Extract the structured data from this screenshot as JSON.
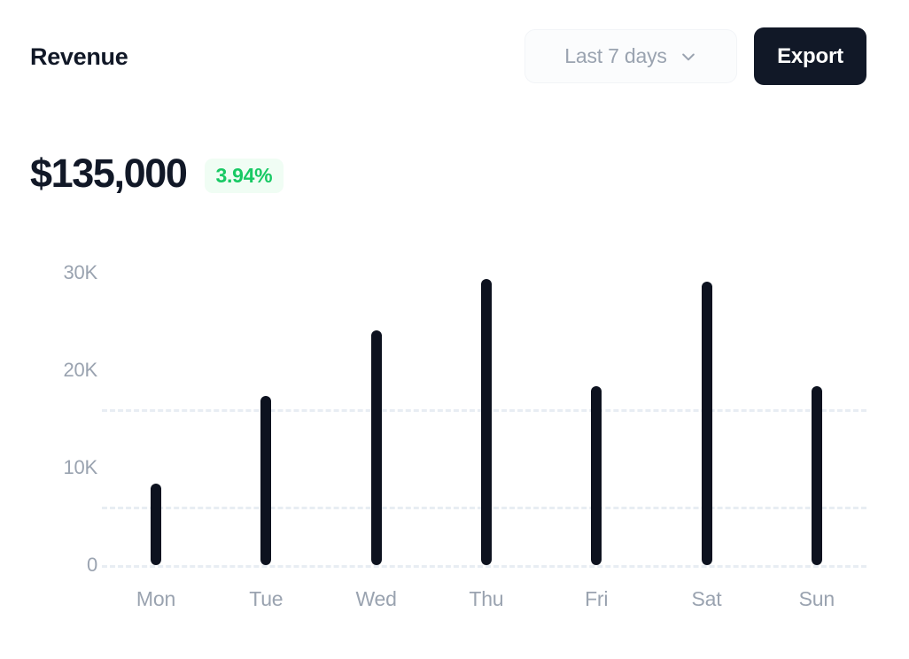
{
  "header": {
    "title": "Revenue",
    "range_select": {
      "value": "Last 7 days",
      "icon": "chevron-down-icon"
    },
    "export_label": "Export"
  },
  "summary": {
    "value": "$135,000",
    "delta": "3.94%",
    "delta_color": "#18c964",
    "delta_bg": "#f0fdf4"
  },
  "colors": {
    "bar": "#0d121f",
    "gridline": "#e8edf3",
    "axis_text": "#9aa3b0",
    "accent_dark": "#111827"
  },
  "chart_data": {
    "type": "bar",
    "title": "Revenue",
    "xlabel": "",
    "ylabel": "",
    "categories": [
      "Mon",
      "Tue",
      "Wed",
      "Thu",
      "Fri",
      "Sat",
      "Sun"
    ],
    "values": [
      8400,
      17400,
      24100,
      29400,
      18400,
      29100,
      18400
    ],
    "ytick_labels": [
      "30K",
      "20K",
      "10K",
      "0"
    ],
    "ytick_values": [
      30000,
      20000,
      10000,
      0
    ],
    "ylim": [
      0,
      33000
    ],
    "gridlines_at": [
      16000,
      6000,
      0
    ],
    "grid": true,
    "legend": false
  }
}
